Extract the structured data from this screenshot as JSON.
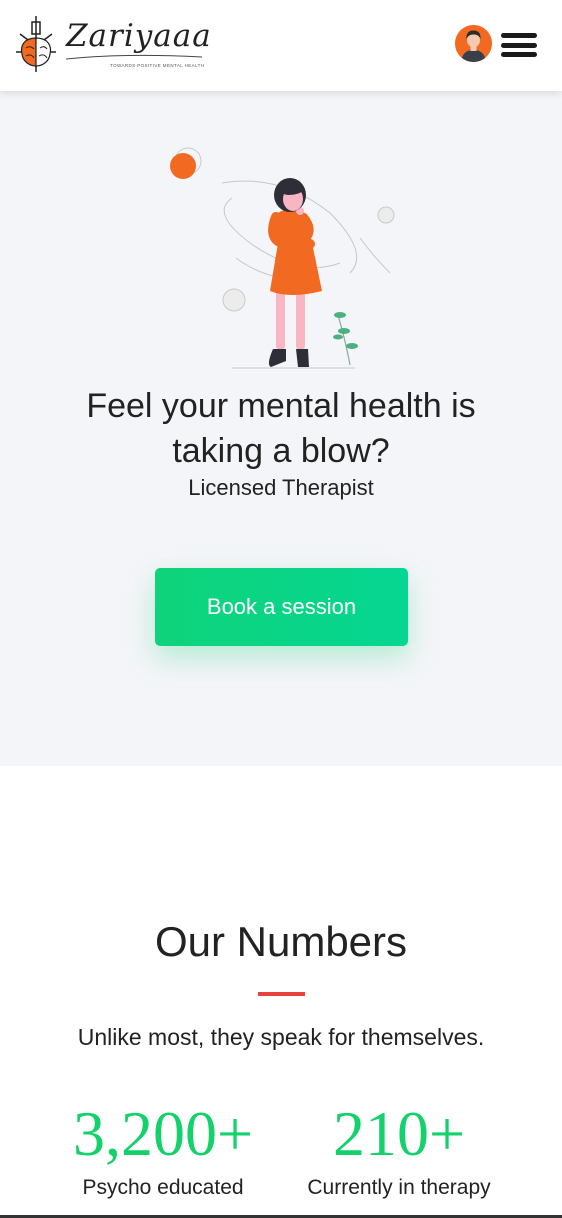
{
  "header": {
    "brand": "Zariyaaa",
    "tagline": "TOWARDS POSITIVE MENTAL HEALTH",
    "logo_icon": "lighthouse-brain-icon",
    "avatar_icon": "user-avatar-icon",
    "menu_icon": "hamburger-menu-icon"
  },
  "hero": {
    "title_line1": "Feel your mental health is",
    "title_line2": "taking a blow?",
    "subtitle": "Licensed Therapist",
    "cta_label": "Book a session",
    "illustration": "thinking-woman-illustration"
  },
  "numbers": {
    "title": "Our Numbers",
    "subtitle": "Unlike most, they speak for themselves.",
    "stats": [
      {
        "value": "3,200+",
        "label": "Psycho educated"
      },
      {
        "value": "210+",
        "label": "Currently in therapy"
      }
    ]
  },
  "colors": {
    "accent_green": "#14d16c",
    "accent_orange": "#f26a21",
    "divider_red": "#e8403c",
    "hero_bg": "#f4f5f8"
  }
}
